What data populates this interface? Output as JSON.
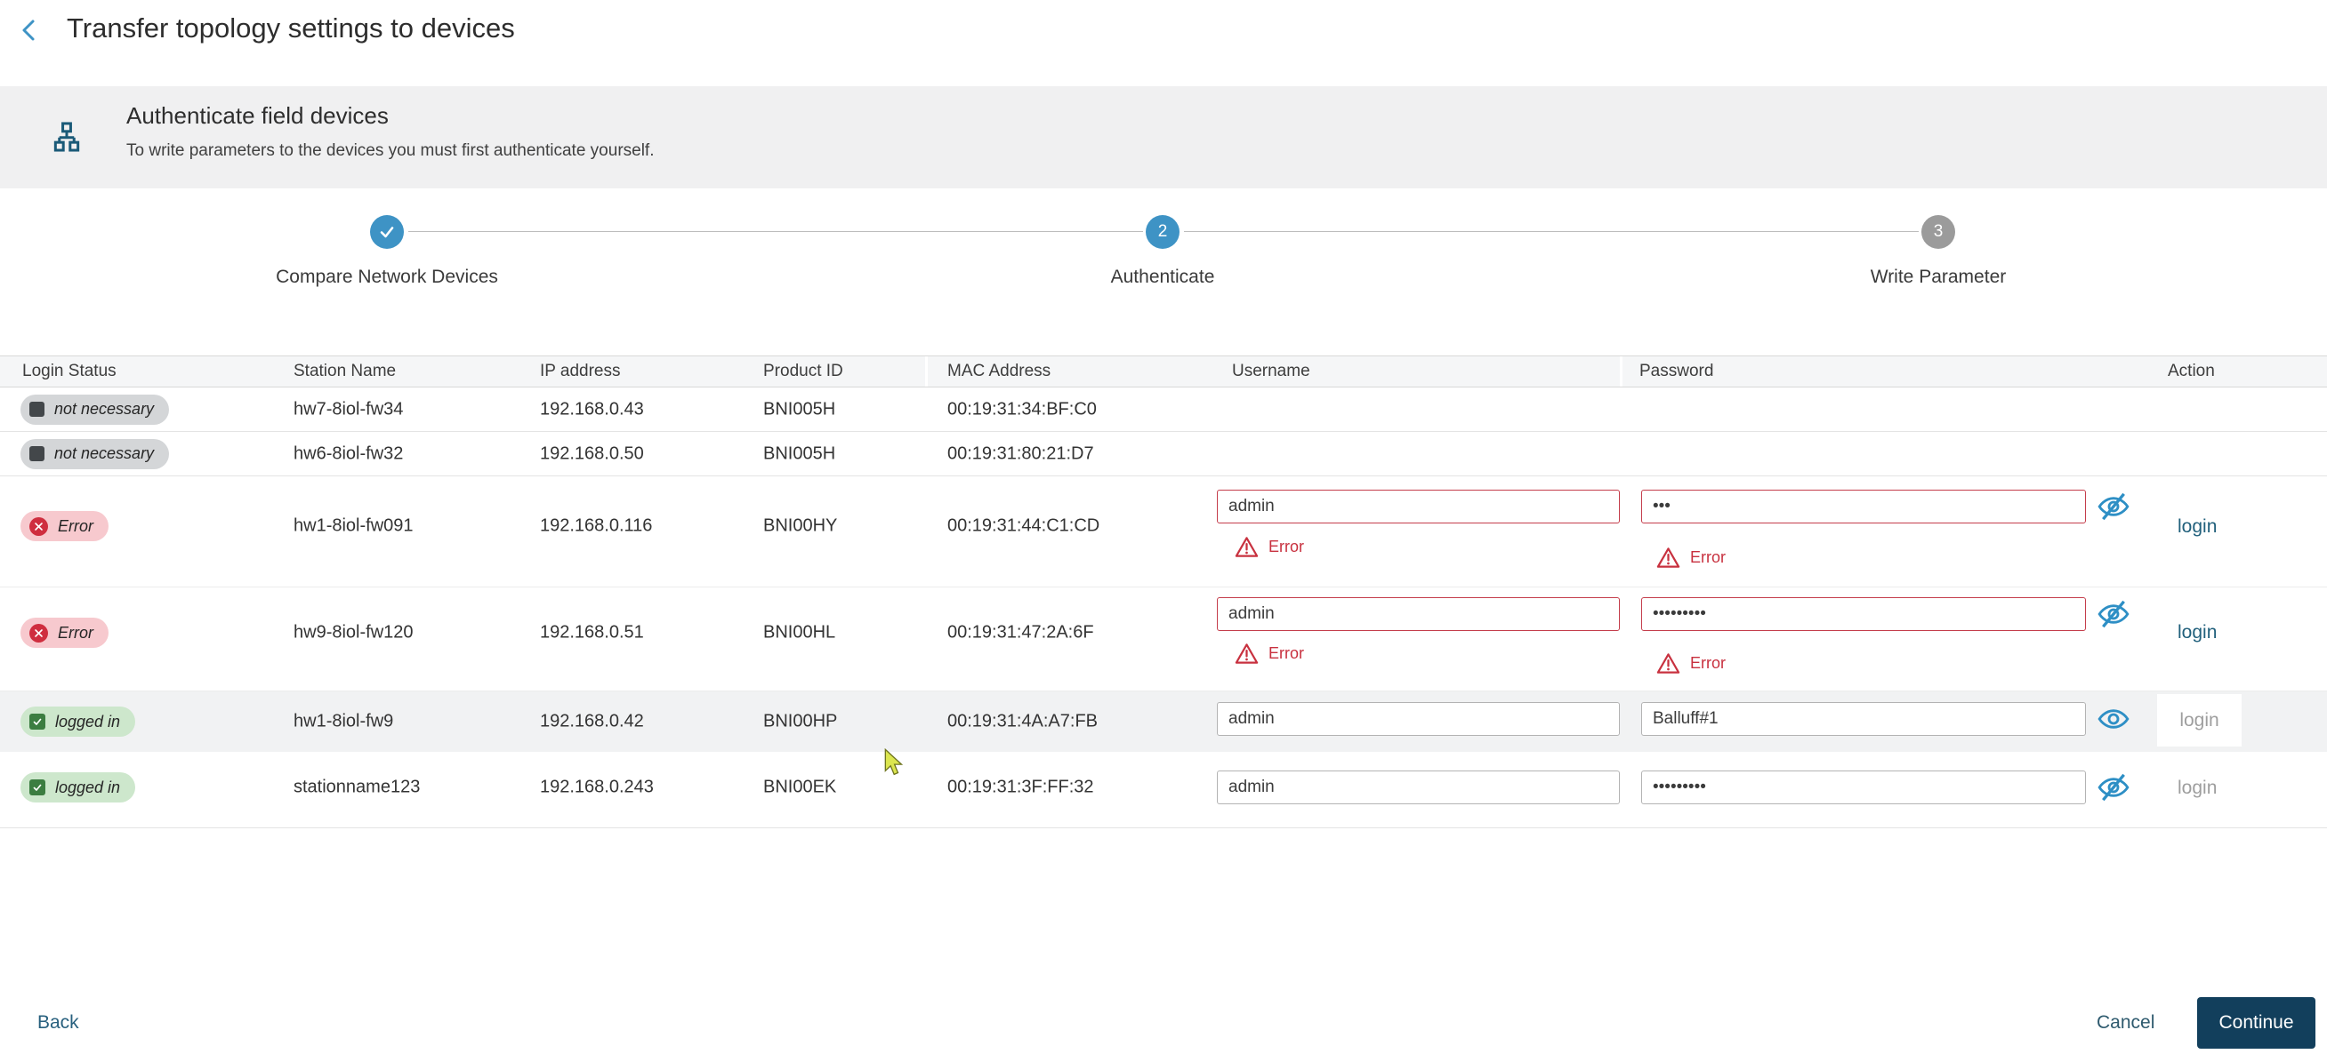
{
  "title_bar": {
    "title": "Transfer topology settings to devices"
  },
  "banner": {
    "title": "Authenticate field devices",
    "subtitle": "To write parameters to the devices you must first authenticate yourself."
  },
  "stepper": {
    "steps": [
      {
        "label": "Compare Network Devices",
        "state": "completed"
      },
      {
        "label": "Authenticate",
        "state": "active",
        "number": "2"
      },
      {
        "label": "Write Parameter",
        "state": "upcoming",
        "number": "3"
      }
    ]
  },
  "table": {
    "headers": {
      "login_status": "Login Status",
      "station_name": "Station Name",
      "ip_address": "IP address",
      "product_id": "Product ID",
      "mac_address": "MAC Address",
      "username": "Username",
      "password": "Password",
      "action": "Action"
    },
    "rows": [
      {
        "status_label": "not necessary",
        "status_type": "neutral",
        "station_name": "hw7-8iol-fw34",
        "ip_address": "192.168.0.43",
        "product_id": "BNI005H",
        "mac_address": "00:19:31:34:BF:C0"
      },
      {
        "status_label": "not necessary",
        "status_type": "neutral",
        "station_name": "hw6-8iol-fw32",
        "ip_address": "192.168.0.50",
        "product_id": "BNI005H",
        "mac_address": "00:19:31:80:21:D7"
      },
      {
        "status_label": "Error",
        "status_type": "error",
        "station_name": "hw1-8iol-fw091",
        "ip_address": "192.168.0.116",
        "product_id": "BNI00HY",
        "mac_address": "00:19:31:44:C1:CD",
        "username_value": "admin",
        "password_value": "•••",
        "username_error": "Error",
        "password_error": "Error",
        "action_label": "login",
        "action_enabled": true
      },
      {
        "status_label": "Error",
        "status_type": "error",
        "station_name": "hw9-8iol-fw120",
        "ip_address": "192.168.0.51",
        "product_id": "BNI00HL",
        "mac_address": "00:19:31:47:2A:6F",
        "username_value": "admin",
        "password_value": "•••••••••",
        "username_error": "Error",
        "password_error": "Error",
        "action_label": "login",
        "action_enabled": true
      },
      {
        "status_label": "logged in",
        "status_type": "success",
        "station_name": "hw1-8iol-fw9",
        "ip_address": "192.168.0.42",
        "product_id": "BNI00HP",
        "mac_address": "00:19:31:4A:A7:FB",
        "username_value": "admin",
        "password_value": "Balluff#1",
        "action_label": "login",
        "action_enabled": false
      },
      {
        "status_label": "logged in",
        "status_type": "success",
        "station_name": "stationname123",
        "ip_address": "192.168.0.243",
        "product_id": "BNI00EK",
        "mac_address": "00:19:31:3F:FF:32",
        "username_value": "admin",
        "password_value": "•••••••••",
        "action_label": "login",
        "action_enabled": false
      }
    ]
  },
  "footer": {
    "back_label": "Back",
    "cancel_label": "Cancel",
    "continue_label": "Continue"
  },
  "colors": {
    "accent_blue": "#3e93c5",
    "continue_navy": "#123f5c",
    "error_red": "#c8313f",
    "link_teal": "#21607c",
    "chip_gray": "#d4d6d8",
    "chip_pink": "#f7c9ce",
    "chip_green": "#cde7cc"
  }
}
